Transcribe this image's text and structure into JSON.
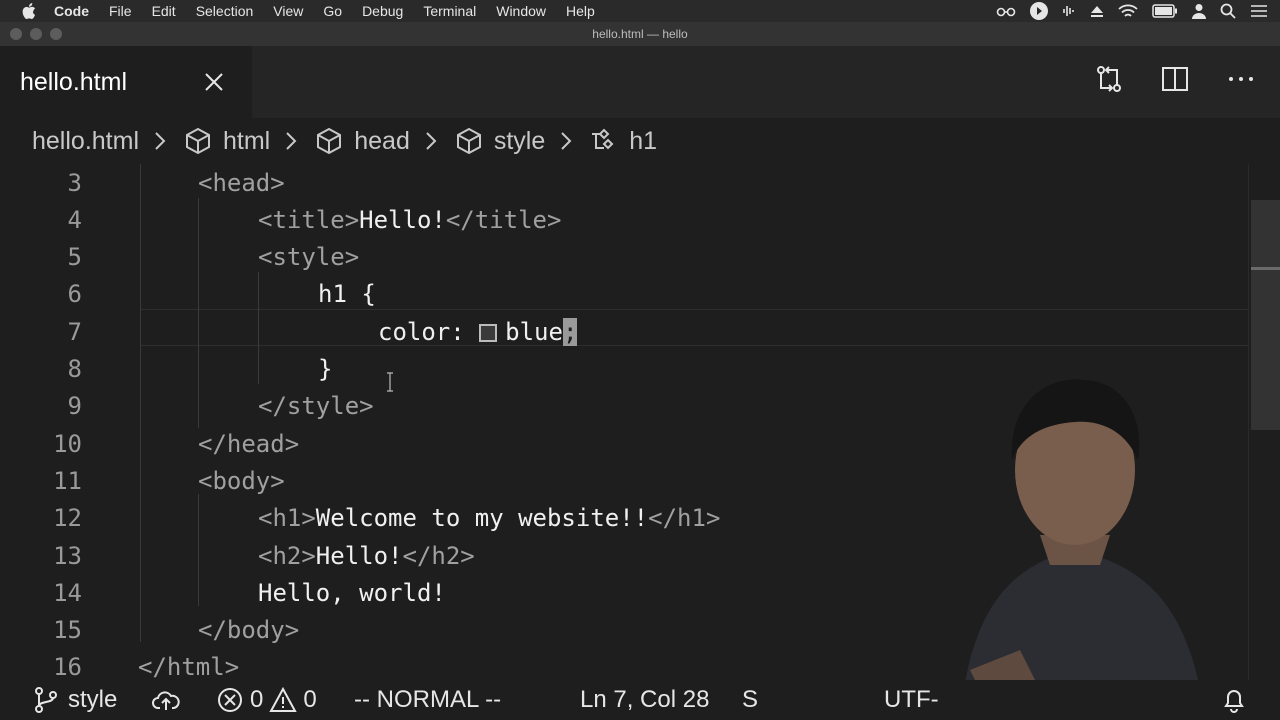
{
  "menubar": {
    "app_name": "Code",
    "items": [
      "File",
      "Edit",
      "Selection",
      "View",
      "Go",
      "Debug",
      "Terminal",
      "Window",
      "Help"
    ]
  },
  "window": {
    "title": "hello.html — hello"
  },
  "tabs": [
    {
      "label": "hello.html",
      "active": true
    }
  ],
  "breadcrumb": [
    {
      "label": "hello.html",
      "icon": "none"
    },
    {
      "label": "html",
      "icon": "cube-icon"
    },
    {
      "label": "head",
      "icon": "cube-icon"
    },
    {
      "label": "style",
      "icon": "cube-icon"
    },
    {
      "label": "h1",
      "icon": "selector-icon"
    }
  ],
  "editor": {
    "current_line": 7,
    "lines": [
      {
        "num": "3",
        "segments": [
          {
            "t": "<head>",
            "c": "tag"
          }
        ]
      },
      {
        "num": "4",
        "segments": [
          {
            "t": "<title>",
            "c": "tag"
          },
          {
            "t": "Hello!",
            "c": "txt"
          },
          {
            "t": "</title>",
            "c": "tag"
          }
        ]
      },
      {
        "num": "5",
        "segments": [
          {
            "t": "<style>",
            "c": "tag"
          }
        ]
      },
      {
        "num": "6",
        "segments": [
          {
            "t": "h1 {",
            "c": "txt"
          }
        ]
      },
      {
        "num": "7",
        "segments": [
          {
            "t": "color: ",
            "c": "txt"
          },
          {
            "t": "",
            "c": "swatch"
          },
          {
            "t": "blue",
            "c": "txt"
          },
          {
            "t": ";",
            "c": "cursor"
          }
        ]
      },
      {
        "num": "8",
        "segments": [
          {
            "t": "}",
            "c": "txt"
          }
        ]
      },
      {
        "num": "9",
        "segments": [
          {
            "t": "</style>",
            "c": "tag"
          }
        ]
      },
      {
        "num": "10",
        "segments": [
          {
            "t": "</head>",
            "c": "tag"
          }
        ]
      },
      {
        "num": "11",
        "segments": [
          {
            "t": "<body>",
            "c": "tag"
          }
        ]
      },
      {
        "num": "12",
        "segments": [
          {
            "t": "<h1>",
            "c": "tag"
          },
          {
            "t": "Welcome to my website!!",
            "c": "txt"
          },
          {
            "t": "</h1>",
            "c": "tag"
          }
        ]
      },
      {
        "num": "13",
        "segments": [
          {
            "t": "<h2>",
            "c": "tag"
          },
          {
            "t": "Hello!",
            "c": "txt"
          },
          {
            "t": "</h2>",
            "c": "tag"
          }
        ]
      },
      {
        "num": "14",
        "segments": [
          {
            "t": "Hello, world!",
            "c": "txt"
          }
        ]
      },
      {
        "num": "15",
        "segments": [
          {
            "t": "</body>",
            "c": "tag"
          }
        ]
      },
      {
        "num": "16",
        "segments": [
          {
            "t": "</html>",
            "c": "tag"
          }
        ]
      }
    ]
  },
  "statusbar": {
    "branch": "style",
    "errors": "0",
    "warnings": "0",
    "mode": "-- NORMAL --",
    "position": "Ln 7, Col 28",
    "spaces_partial": "S",
    "encoding_partial": "UTF-"
  },
  "colors": {
    "background": "#1e1e1e",
    "tag": "#a0a0a0",
    "text": "#f0f0f0",
    "line_number": "#9a9a9a"
  }
}
